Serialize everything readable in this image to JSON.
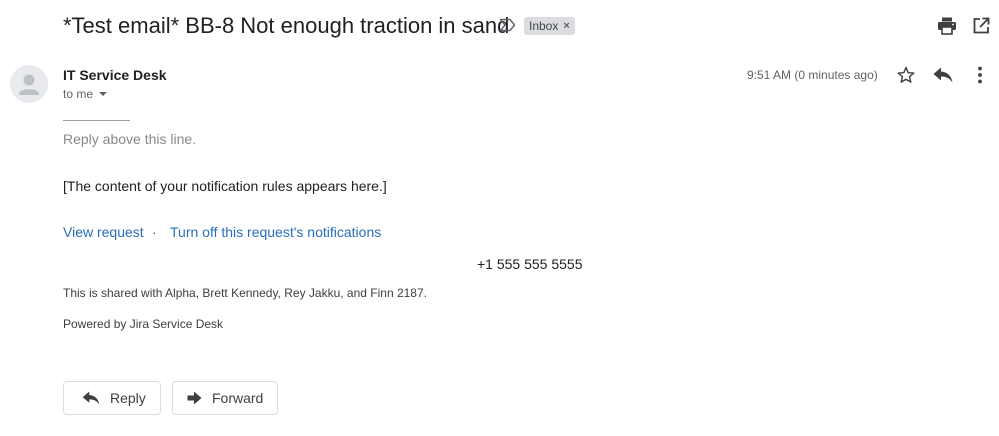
{
  "email": {
    "subject": "*Test email* BB-8 Not enough traction in sand",
    "label": "Inbox",
    "label_remove": "×",
    "sender": "IT Service Desk",
    "to": "to me",
    "time": "9:51 AM (0 minutes ago)"
  },
  "body": {
    "reply_above": "Reply above this line.",
    "content": "[The content of your notification rules appears here.]",
    "view_request": "View request",
    "separator": "·",
    "turn_off": "Turn off this request's notifications",
    "phone": "+1 555 555 5555",
    "shared": "This is shared with Alpha, Brett Kennedy, Rey Jakku, and Finn 2187.",
    "powered": "Powered by Jira Service Desk"
  },
  "actions": {
    "reply": "Reply",
    "forward": "Forward"
  },
  "icons": {
    "importance": "importance-marker-icon",
    "print": "print-icon",
    "new_window": "open-in-new-window-icon",
    "star": "star-icon",
    "reply": "reply-icon",
    "more": "more-vert-icon",
    "avatar": "person-avatar-icon",
    "forward": "forward-icon"
  },
  "colors": {
    "link": "#2a6ebb",
    "chip": "#dadce0",
    "text": "#202124",
    "muted": "#5f6368"
  }
}
